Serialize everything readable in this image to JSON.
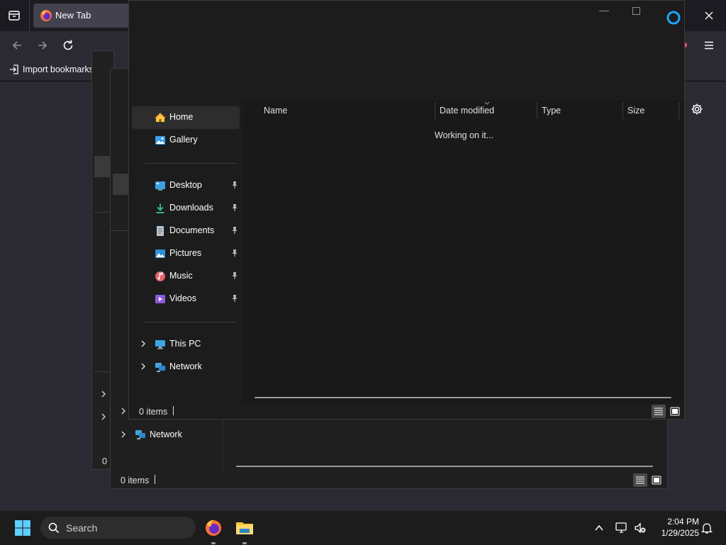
{
  "browser": {
    "tab_title": "New Tab",
    "bookmark_label": "Import bookmarks"
  },
  "explorer": {
    "nav_items": [
      {
        "label": "Home",
        "icon": "home-icon"
      },
      {
        "label": "Gallery",
        "icon": "gallery-icon"
      },
      {
        "label": "Desktop",
        "icon": "desktop-folder-icon"
      },
      {
        "label": "Downloads",
        "icon": "downloads-folder-icon"
      },
      {
        "label": "Documents",
        "icon": "documents-folder-icon"
      },
      {
        "label": "Pictures",
        "icon": "pictures-folder-icon"
      },
      {
        "label": "Music",
        "icon": "music-folder-icon"
      },
      {
        "label": "Videos",
        "icon": "videos-folder-icon"
      },
      {
        "label": "This PC",
        "icon": "this-pc-icon"
      },
      {
        "label": "Network",
        "icon": "network-icon"
      }
    ],
    "columns": [
      "Name",
      "Date modified",
      "Type",
      "Size"
    ],
    "loading_text": "Working on it...",
    "status": "0 items"
  },
  "back_explorer": {
    "network_label": "Network",
    "status": "0 items",
    "status_short": "0"
  },
  "taskbar": {
    "search_placeholder": "Search",
    "time": "2:04 PM",
    "date": "1/29/2025"
  },
  "colors": {
    "accent": "#60cdff",
    "folder": "#ffc83d",
    "firefox_orange": "#ff7139"
  }
}
